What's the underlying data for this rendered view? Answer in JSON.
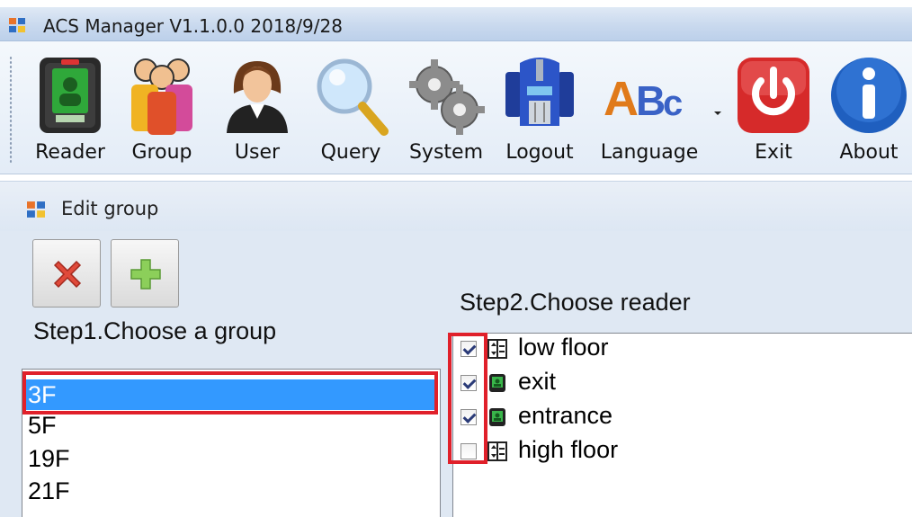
{
  "window": {
    "title": "ACS Manager V1.1.0.0  2018/9/28"
  },
  "toolbar": {
    "items": [
      {
        "label": "Reader",
        "icon": "reader-device-icon"
      },
      {
        "label": "Group",
        "icon": "group-people-icon"
      },
      {
        "label": "User",
        "icon": "user-person-icon"
      },
      {
        "label": "Query",
        "icon": "magnifier-icon"
      },
      {
        "label": "System",
        "icon": "gears-icon"
      },
      {
        "label": "Logout",
        "icon": "robot-head-icon"
      },
      {
        "label": "Language",
        "icon": "abc-letters-icon"
      },
      {
        "label": "Exit",
        "icon": "power-icon"
      },
      {
        "label": "About",
        "icon": "info-icon"
      }
    ]
  },
  "panel": {
    "title": "Edit group"
  },
  "actions": {
    "delete_icon": "red-x-icon",
    "add_icon": "green-plus-icon"
  },
  "step1": {
    "label": "Step1.Choose a group"
  },
  "step2": {
    "label": "Step2.Choose reader"
  },
  "groups": {
    "items": [
      "3F",
      "5F",
      "19F",
      "21F"
    ],
    "selected": "3F"
  },
  "readers": {
    "items": [
      {
        "label": "low floor",
        "checked": true,
        "icon": "elevator-icon"
      },
      {
        "label": "exit",
        "checked": true,
        "icon": "door-reader-icon"
      },
      {
        "label": "entrance",
        "checked": true,
        "icon": "door-reader-icon"
      },
      {
        "label": "high floor",
        "checked": false,
        "icon": "elevator-icon"
      }
    ]
  },
  "colors": {
    "selection": "#3399ff",
    "highlight_box": "#e0202a"
  }
}
